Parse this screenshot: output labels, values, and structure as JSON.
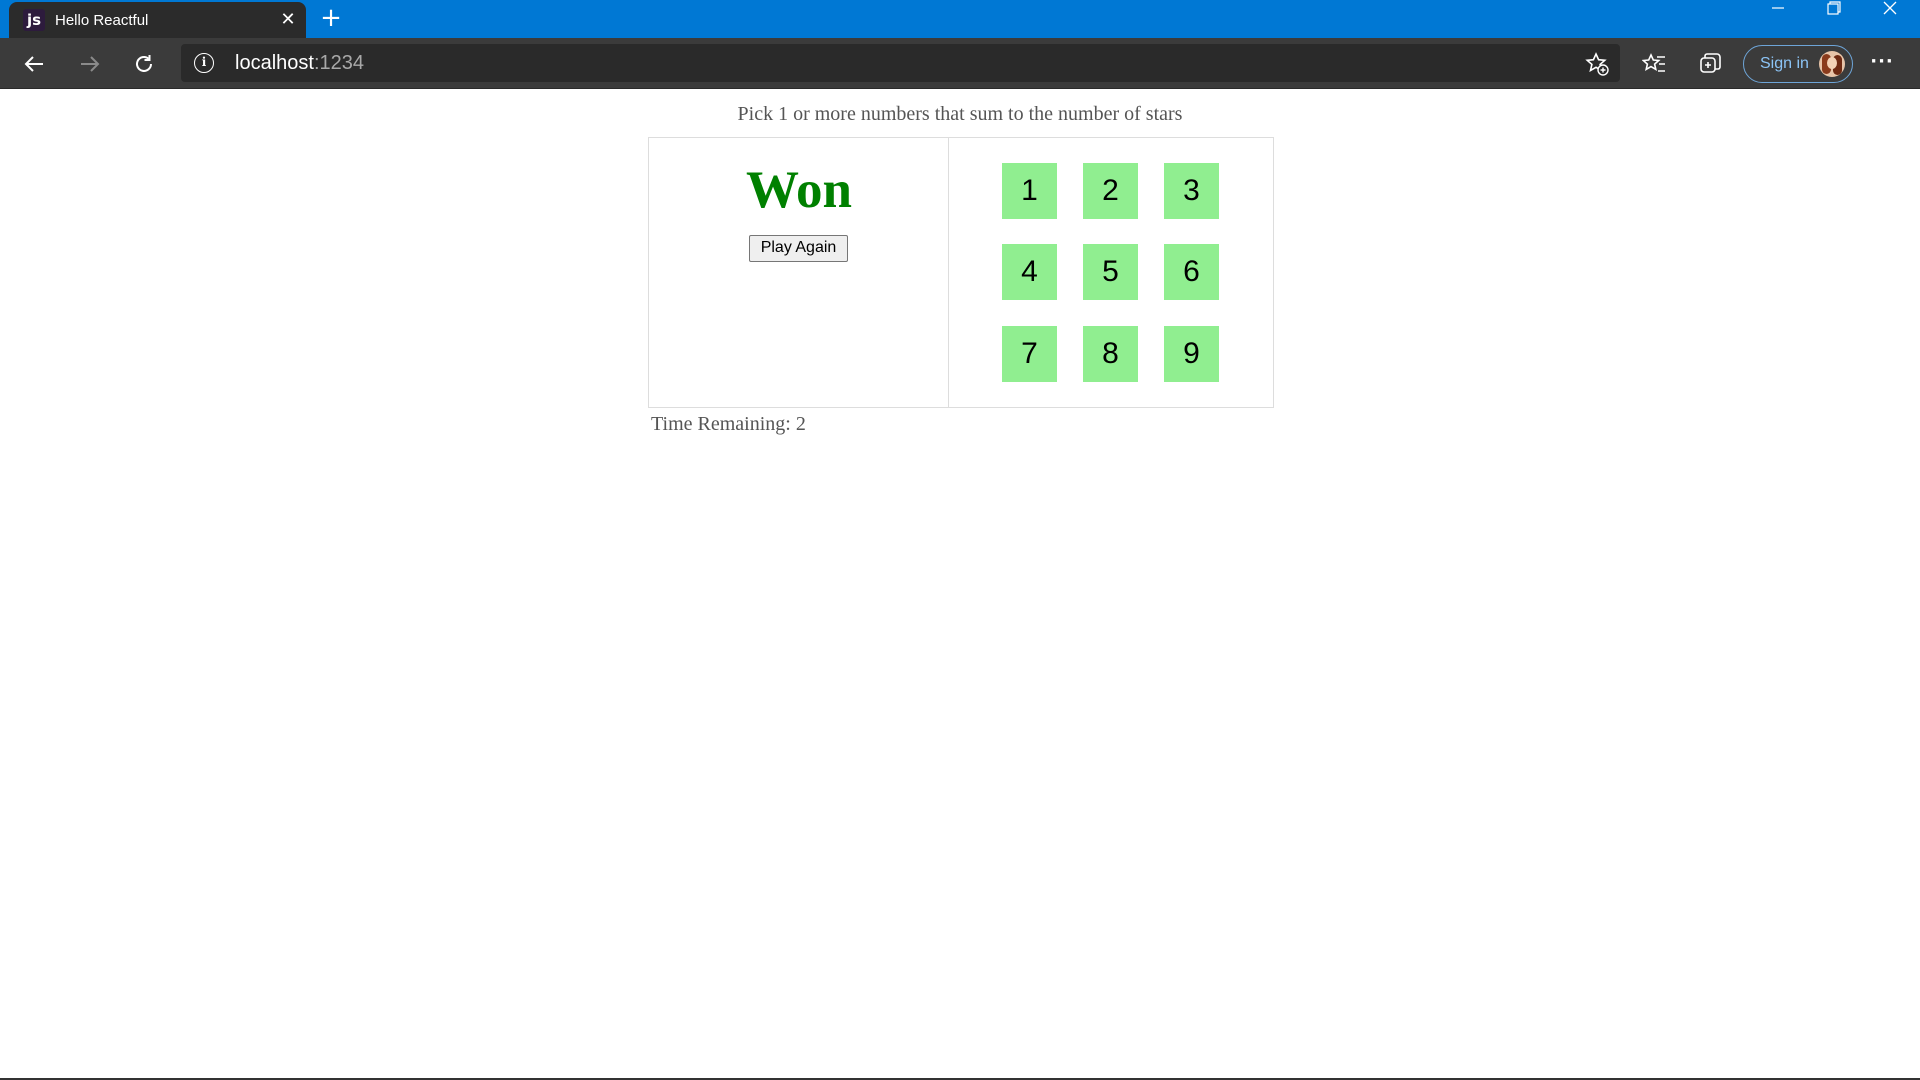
{
  "browser": {
    "tab": {
      "favicon": "js",
      "title": "Hello Reactful"
    },
    "address": {
      "host": "localhost",
      "port": ":1234"
    },
    "signin_label": "Sign in",
    "icons": {
      "close_tab": "close-icon",
      "new_tab": "plus-icon",
      "back": "back-arrow-icon",
      "forward": "forward-arrow-icon",
      "refresh": "refresh-icon",
      "site_info": "info-icon",
      "add_favorite": "star-plus-icon",
      "favorites": "favorites-list-icon",
      "collections": "collections-icon",
      "more": "more-icon",
      "minimize": "minimize-icon",
      "maximize": "restore-icon",
      "close_window": "close-icon"
    },
    "colors": {
      "titlebar": "#0078d4",
      "toolbar": "#3b3b3b",
      "tab": "#2b2b2b"
    }
  },
  "game": {
    "help": "Pick 1 or more numbers that sum to the number of stars",
    "status": "Won",
    "play_again_label": "Play Again",
    "numbers": [
      "1",
      "2",
      "3",
      "4",
      "5",
      "6",
      "7",
      "8",
      "9"
    ],
    "timer_text": "Time Remaining: 2",
    "colors": {
      "status": "#008000",
      "number_used": "#90ee90"
    }
  }
}
